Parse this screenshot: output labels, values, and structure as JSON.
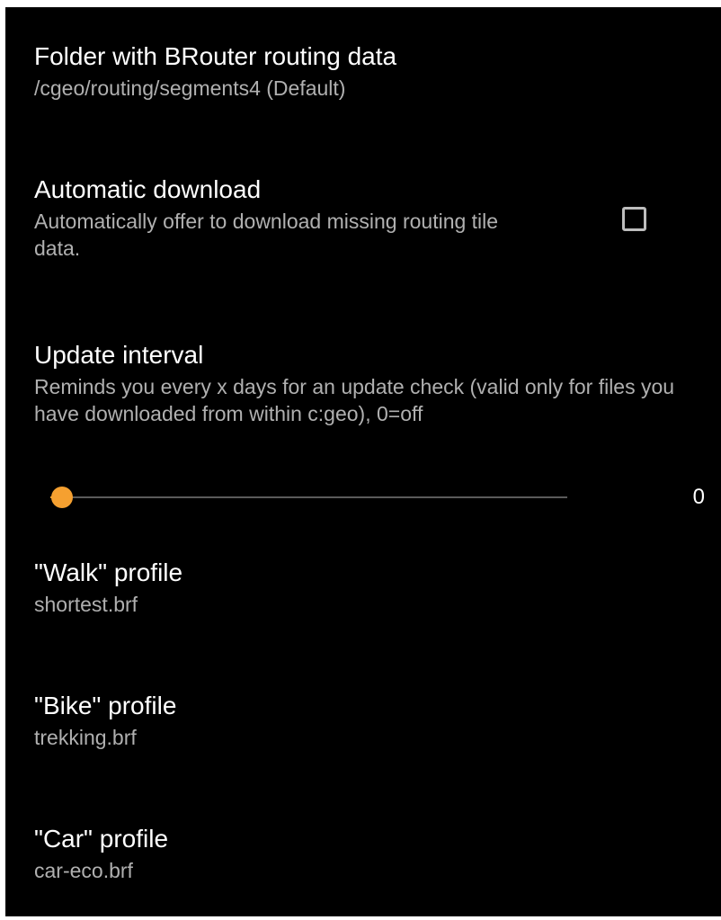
{
  "preferences": {
    "folder": {
      "title": "Folder with BRouter routing data",
      "summary": "/cgeo/routing/segments4 (Default)"
    },
    "auto_download": {
      "title": "Automatic download",
      "summary": "Automatically offer to download missing routing tile data.",
      "checked": false
    },
    "update_interval": {
      "title": "Update interval",
      "summary": "Reminds you every x days for an update check (valid only for files you have downloaded from within c:geo), 0=off",
      "value": "0",
      "fraction": 0.0
    },
    "walk_profile": {
      "title": "\"Walk\" profile",
      "summary": "shortest.brf"
    },
    "bike_profile": {
      "title": "\"Bike\" profile",
      "summary": "trekking.brf"
    },
    "car_profile": {
      "title": "\"Car\" profile",
      "summary": "car-eco.brf"
    }
  },
  "colors": {
    "background": "#000000",
    "accent": "#f5a030",
    "title_text": "#ffffff",
    "summary_text": "#b0b0b0"
  }
}
